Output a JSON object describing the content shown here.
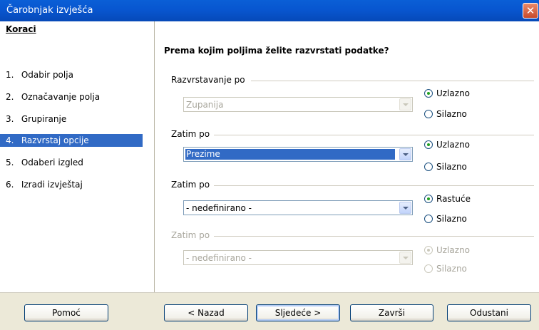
{
  "window": {
    "title": "Čarobnjak izvješća",
    "close": "✕"
  },
  "sidebar": {
    "title": "Koraci",
    "steps": [
      {
        "num": "1.",
        "label": "Odabir polja"
      },
      {
        "num": "2.",
        "label": "Označavanje polja"
      },
      {
        "num": "3.",
        "label": "Grupiranje"
      },
      {
        "num": "4.",
        "label": "Razvrstaj opcije"
      },
      {
        "num": "5.",
        "label": "Odaberi izgled"
      },
      {
        "num": "6.",
        "label": "Izradi izvještaj"
      }
    ]
  },
  "main": {
    "heading": "Prema kojim poljima želite razvrstati podatke?",
    "groups": [
      {
        "label": "Razvrstavanje po",
        "value": "Zupanija",
        "radio1": "Uzlazno",
        "radio2": "Silazno"
      },
      {
        "label": "Zatim po",
        "value": "Prezime",
        "radio1": "Uzlazno",
        "radio2": "Silazno"
      },
      {
        "label": "Zatim po",
        "value": "- nedefinirano -",
        "radio1": "Rastuće",
        "radio2": "Silazno"
      },
      {
        "label": "Zatim po",
        "value": "- nedefinirano -",
        "radio1": "Uzlazno",
        "radio2": "Silazno"
      }
    ]
  },
  "footer": {
    "help": "Pomoć",
    "back": "< Nazad",
    "next": "Sljedeće >",
    "finish": "Završi",
    "cancel": "Odustani"
  }
}
